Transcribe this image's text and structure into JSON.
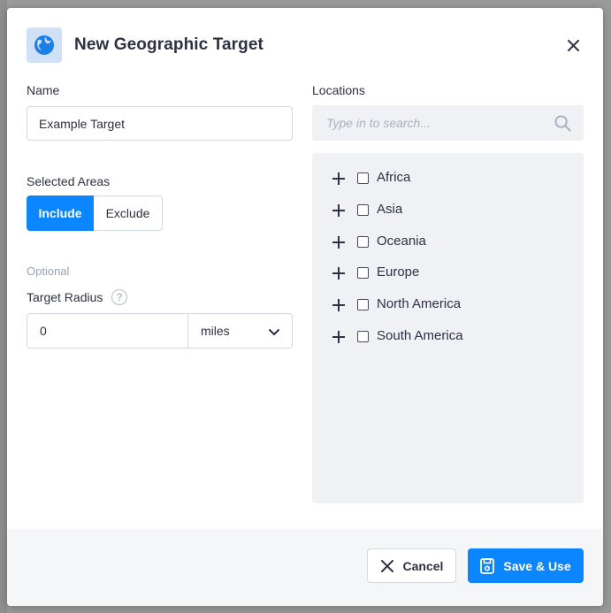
{
  "dialog": {
    "title": "New Geographic Target",
    "icon": "globe-icon",
    "close_icon": "close-icon"
  },
  "name_field": {
    "label": "Name",
    "value": "Example Target"
  },
  "selected_areas": {
    "label": "Selected Areas",
    "include_label": "Include",
    "exclude_label": "Exclude",
    "active": "Include"
  },
  "radius": {
    "optional_label": "Optional",
    "label": "Target Radius",
    "help_icon": "question-icon",
    "help_glyph": "?",
    "value": "0",
    "unit": "miles"
  },
  "locations": {
    "label": "Locations",
    "search_placeholder": "Type in to search...",
    "items": [
      {
        "label": "Africa",
        "checked": false
      },
      {
        "label": "Asia",
        "checked": false
      },
      {
        "label": "Oceania",
        "checked": false
      },
      {
        "label": "Europe",
        "checked": false
      },
      {
        "label": "North America",
        "checked": false
      },
      {
        "label": "South America",
        "checked": false
      }
    ]
  },
  "footer": {
    "cancel_label": "Cancel",
    "save_label": "Save & Use"
  },
  "colors": {
    "accent": "#0c86ff",
    "panel_bg": "#f0f1f4",
    "text": "#2d3142"
  }
}
